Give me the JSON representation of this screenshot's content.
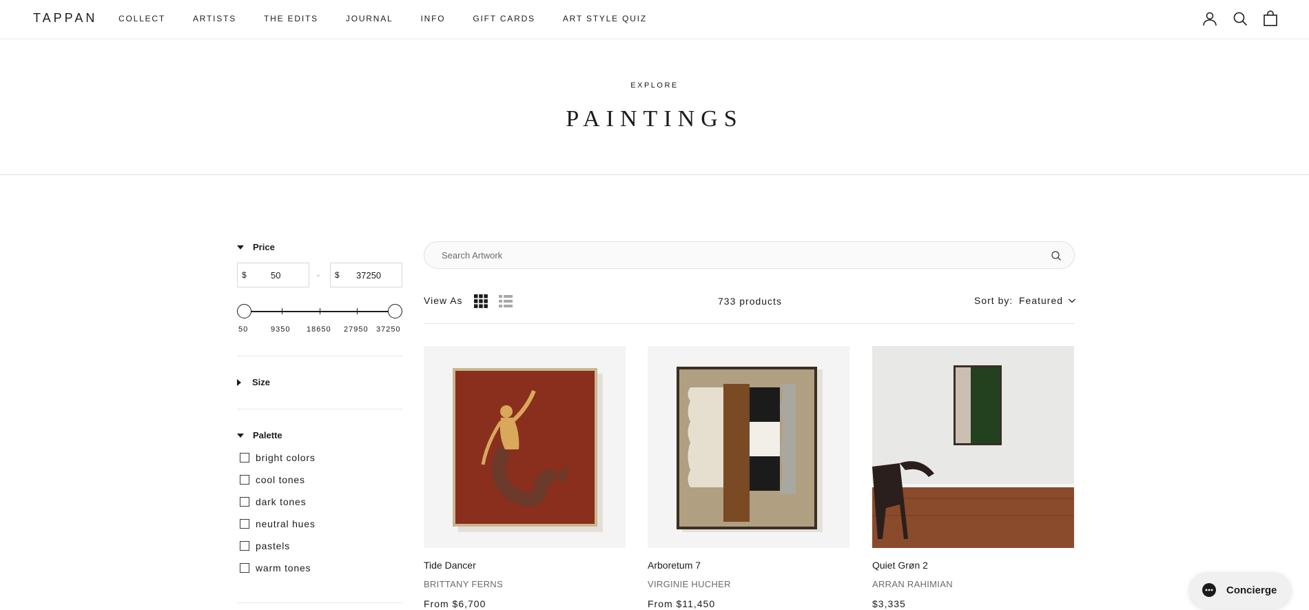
{
  "header": {
    "logo": "TAPPAN",
    "nav": [
      "COLLECT",
      "ARTISTS",
      "THE EDITS",
      "JOURNAL",
      "INFO",
      "GIFT CARDS",
      "ART STYLE QUIZ"
    ],
    "icons": [
      "account-icon",
      "search-icon",
      "cart-icon"
    ]
  },
  "hero": {
    "subtitle": "EXPLORE",
    "title": "PAINTINGS"
  },
  "filters": {
    "price": {
      "label": "Price",
      "currency": "$",
      "min": "50",
      "max": "37250",
      "dash": "-",
      "ticks": [
        "50",
        "9350",
        "18650",
        "27950",
        "37250"
      ]
    },
    "size": {
      "label": "Size"
    },
    "palette": {
      "label": "Palette",
      "options": [
        "bright colors",
        "cool tones",
        "dark tones",
        "neutral hues",
        "pastels",
        "warm tones"
      ]
    }
  },
  "toolbar": {
    "search_placeholder": "Search Artwork",
    "view_as": "View As",
    "count": "733 products",
    "sort_label": "Sort by:",
    "sort_value": "Featured"
  },
  "products": [
    {
      "title": "Tide Dancer",
      "artist": "BRITTANY FERNS",
      "price": "From $6,700"
    },
    {
      "title": "Arboretum 7",
      "artist": "VIRGINIE HUCHER",
      "price": "From $11,450"
    },
    {
      "title": "Quiet Grøn 2",
      "artist": "ARRAN RAHIMIAN",
      "price": "$3,335"
    }
  ],
  "concierge": {
    "label": "Concierge"
  },
  "colors": {
    "text": "#1c1b1b",
    "muted": "#6b6b6b",
    "border": "#e6e6e6"
  }
}
